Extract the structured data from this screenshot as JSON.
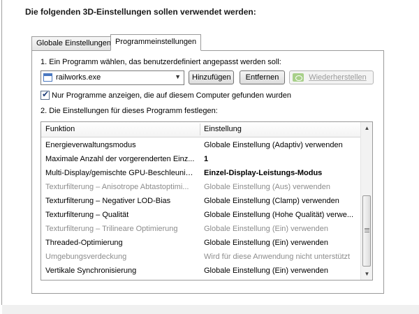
{
  "page": {
    "title": "Die folgenden 3D-Einstellungen sollen verwendet werden:"
  },
  "tabs": [
    {
      "label": "Globale Einstellungen",
      "active": false
    },
    {
      "label": "Programmeinstellungen",
      "active": true
    }
  ],
  "step1": {
    "label": "1. Ein Programm wählen, das benutzerdefiniert angepasst werden soll:",
    "program_select": {
      "value": "railworks.exe",
      "icon": "application-window-icon"
    },
    "buttons": {
      "add": "Hinzufügen",
      "remove": "Entfernen",
      "restore": "Wiederherstellen",
      "restore_icon": "nvidia-icon"
    },
    "checkbox": {
      "checked": true,
      "label": "Nur Programme anzeigen, die auf diesem Computer gefunden wurden"
    }
  },
  "step2": {
    "label": "2. Die Einstellungen für dieses Programm festlegen:",
    "columns": [
      "Funktion",
      "Einstellung"
    ],
    "rows": [
      {
        "function": "Energieverwaltungsmodus",
        "setting": "Globale Einstellung (Adaptiv) verwenden",
        "disabled": false,
        "bold": false
      },
      {
        "function": "Maximale Anzahl der vorgerenderten Einz...",
        "setting": "1",
        "disabled": false,
        "bold": true
      },
      {
        "function": "Multi-Display/gemischte GPU-Beschleunigung",
        "setting": "Einzel-Display-Leistungs-Modus",
        "disabled": false,
        "bold": true
      },
      {
        "function": "Texturfilterung – Anisotrope Abtastoptimi...",
        "setting": "Globale Einstellung (Aus) verwenden",
        "disabled": true,
        "bold": false
      },
      {
        "function": "Texturfilterung – Negativer LOD-Bias",
        "setting": "Globale Einstellung (Clamp) verwenden",
        "disabled": false,
        "bold": false
      },
      {
        "function": "Texturfilterung – Qualität",
        "setting": "Globale Einstellung (Hohe Qualität) verwe...",
        "disabled": false,
        "bold": false
      },
      {
        "function": "Texturfilterung – Trilineare Optimierung",
        "setting": "Globale Einstellung (Ein) verwenden",
        "disabled": true,
        "bold": false
      },
      {
        "function": "Threaded-Optimierung",
        "setting": "Globale Einstellung (Ein) verwenden",
        "disabled": false,
        "bold": false
      },
      {
        "function": "Umgebungsverdeckung",
        "setting": "Wird für diese Anwendung nicht unterstützt",
        "disabled": true,
        "bold": false
      },
      {
        "function": "Vertikale Synchronisierung",
        "setting": "Globale Einstellung (Ein) verwenden",
        "disabled": false,
        "bold": false
      }
    ],
    "scrollbar": {
      "position": "bottom"
    }
  },
  "colors": {
    "disabled_text": "#8c8c8c",
    "border": "#9a9a9a"
  }
}
